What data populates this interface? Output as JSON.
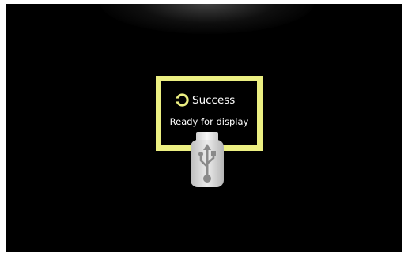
{
  "status": {
    "title": "Success",
    "message": "Ready for display",
    "icon": "status-ring-icon",
    "accent_color": "#ecef82"
  },
  "device": {
    "icon": "usb-drive-icon",
    "symbol": "usb-symbol-icon"
  }
}
